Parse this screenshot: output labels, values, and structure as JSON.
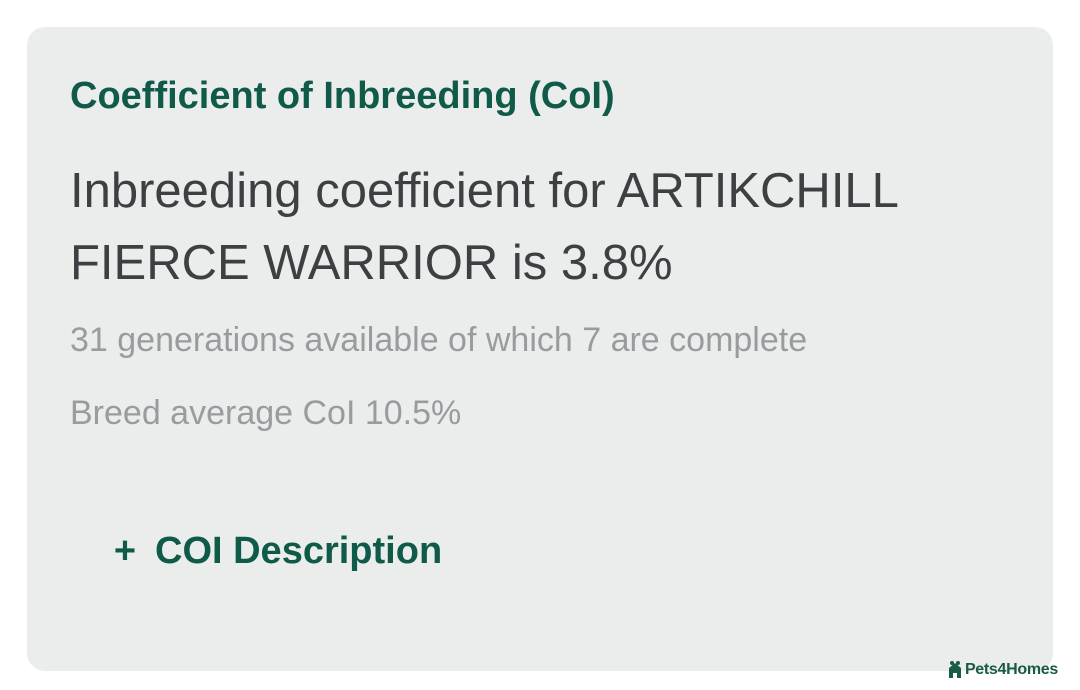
{
  "card": {
    "heading": "Coefficient of Inbreeding (CoI)",
    "result": "Inbreeding coefficient for ARTIKCHILL FIERCE WARRIOR is 3.8%",
    "generations": "31 generations available of which 7 are complete",
    "breed_average": "Breed average CoI 10.5%",
    "toggle": {
      "icon": "+",
      "label": "COI Description"
    }
  },
  "brand": {
    "name": "Pets4Homes",
    "color": "#1a5b43"
  },
  "colors": {
    "accent": "#0f5a48",
    "card_background": "#ebedec",
    "primary_text": "#3d3f42",
    "muted_text": "#999c9f"
  }
}
